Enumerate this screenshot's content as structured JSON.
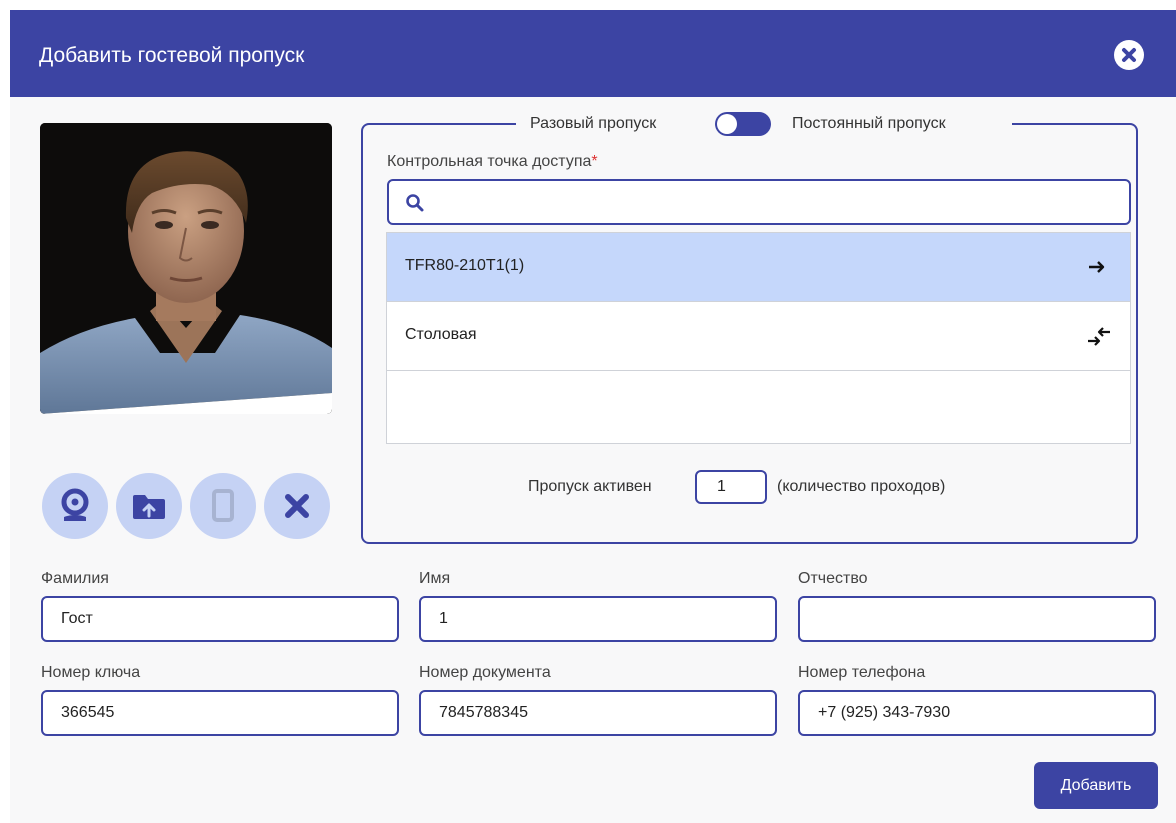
{
  "dialog": {
    "title": "Добавить гостевой пропуск",
    "close_icon": "close-icon"
  },
  "photo": {
    "alt": "Фото гостя"
  },
  "photo_actions": [
    {
      "name": "webcam-button",
      "icon": "webcam-icon",
      "enabled": true
    },
    {
      "name": "upload-folder-button",
      "icon": "folder-upload-icon",
      "enabled": true
    },
    {
      "name": "card-button",
      "icon": "card-icon",
      "enabled": false
    },
    {
      "name": "remove-photo-button",
      "icon": "close-icon",
      "enabled": true
    }
  ],
  "pass_type": {
    "one_time_label": "Разовый пропуск",
    "permanent_label": "Постоянный пропуск",
    "selected": "one_time"
  },
  "access_point": {
    "label": "Контрольная точка доступа",
    "required_mark": "*",
    "search_value": "",
    "items": [
      {
        "name": "TFR80-210T1(1)",
        "direction_icon": "arrow-right-icon",
        "selected": true
      },
      {
        "name": "Столовая",
        "direction_icon": "bidirectional-arrows-icon",
        "selected": false
      }
    ]
  },
  "pass_active": {
    "prefix": "Пропуск активен",
    "count": "1",
    "suffix": "(количество проходов)"
  },
  "fields": {
    "last_name": {
      "label": "Фамилия",
      "value": "Гост"
    },
    "first_name": {
      "label": "Имя",
      "value": "1"
    },
    "middle_name": {
      "label": "Отчество",
      "value": ""
    },
    "key_number": {
      "label": "Номер ключа",
      "value": "366545"
    },
    "document_number": {
      "label": "Номер документа",
      "value": "7845788345"
    },
    "phone_number": {
      "label": "Номер телефона",
      "value": "+7 (925) 343-7930"
    }
  },
  "submit_label": "Добавить",
  "colors": {
    "header": "#3c44a3",
    "accent_light": "#c5d2f4",
    "selected_row": "#c5d7fb",
    "background": "#f8f8f9"
  }
}
